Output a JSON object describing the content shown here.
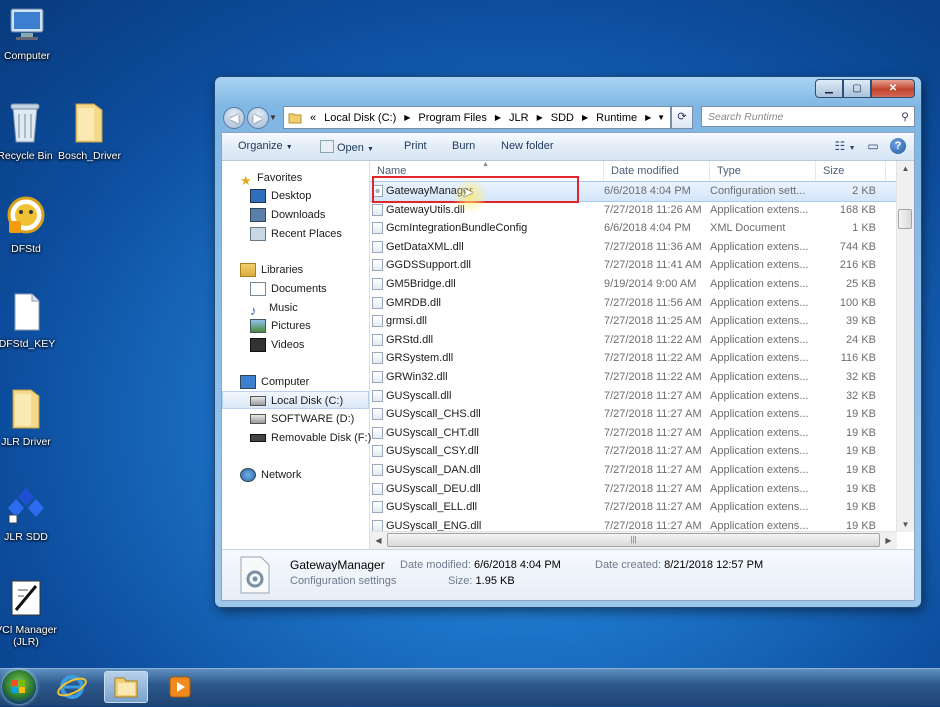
{
  "desktop": {
    "icons": [
      {
        "label": "Computer"
      },
      {
        "label": "Recycle Bin"
      },
      {
        "label": "Bosch_Driver"
      },
      {
        "label": "DFStd"
      },
      {
        "label": "DFStd_KEY"
      },
      {
        "label": "JLR Driver"
      },
      {
        "label": "JLR SDD"
      },
      {
        "label": "VCI Manager (JLR)"
      }
    ]
  },
  "explorer": {
    "address": {
      "prefix": "«",
      "segments": [
        "Local Disk (C:)",
        "Program Files",
        "JLR",
        "SDD",
        "Runtime"
      ]
    },
    "search_placeholder": "Search Runtime",
    "toolbar": {
      "organize": "Organize",
      "open": "Open",
      "print": "Print",
      "burn": "Burn",
      "new_folder": "New folder"
    },
    "nav": {
      "favorites": "Favorites",
      "desktop": "Desktop",
      "downloads": "Downloads",
      "recent": "Recent Places",
      "libraries": "Libraries",
      "documents": "Documents",
      "music": "Music",
      "pictures": "Pictures",
      "videos": "Videos",
      "computer": "Computer",
      "local_disk": "Local Disk (C:)",
      "software": "SOFTWARE (D:)",
      "removable": "Removable Disk (F:)",
      "network": "Network"
    },
    "columns": {
      "name": "Name",
      "date": "Date modified",
      "type": "Type",
      "size": "Size"
    },
    "files": [
      {
        "name": "GatewayManager",
        "date": "6/6/2018 4:04 PM",
        "type": "Configuration sett...",
        "size": "2 KB",
        "selected": true
      },
      {
        "name": "GatewayUtils.dll",
        "date": "7/27/2018 11:26 AM",
        "type": "Application extens...",
        "size": "168 KB"
      },
      {
        "name": "GcmIntegrationBundleConfig",
        "date": "6/6/2018 4:04 PM",
        "type": "XML Document",
        "size": "1 KB"
      },
      {
        "name": "GetDataXML.dll",
        "date": "7/27/2018 11:36 AM",
        "type": "Application extens...",
        "size": "744 KB"
      },
      {
        "name": "GGDSSupport.dll",
        "date": "7/27/2018 11:41 AM",
        "type": "Application extens...",
        "size": "216 KB"
      },
      {
        "name": "GM5Bridge.dll",
        "date": "9/19/2014 9:00 AM",
        "type": "Application extens...",
        "size": "25 KB"
      },
      {
        "name": "GMRDB.dll",
        "date": "7/27/2018 11:56 AM",
        "type": "Application extens...",
        "size": "100 KB"
      },
      {
        "name": "grmsi.dll",
        "date": "7/27/2018 11:25 AM",
        "type": "Application extens...",
        "size": "39 KB"
      },
      {
        "name": "GRStd.dll",
        "date": "7/27/2018 11:22 AM",
        "type": "Application extens...",
        "size": "24 KB"
      },
      {
        "name": "GRSystem.dll",
        "date": "7/27/2018 11:22 AM",
        "type": "Application extens...",
        "size": "116 KB"
      },
      {
        "name": "GRWin32.dll",
        "date": "7/27/2018 11:22 AM",
        "type": "Application extens...",
        "size": "32 KB"
      },
      {
        "name": "GUSyscall.dll",
        "date": "7/27/2018 11:27 AM",
        "type": "Application extens...",
        "size": "32 KB"
      },
      {
        "name": "GUSyscall_CHS.dll",
        "date": "7/27/2018 11:27 AM",
        "type": "Application extens...",
        "size": "19 KB"
      },
      {
        "name": "GUSyscall_CHT.dll",
        "date": "7/27/2018 11:27 AM",
        "type": "Application extens...",
        "size": "19 KB"
      },
      {
        "name": "GUSyscall_CSY.dll",
        "date": "7/27/2018 11:27 AM",
        "type": "Application extens...",
        "size": "19 KB"
      },
      {
        "name": "GUSyscall_DAN.dll",
        "date": "7/27/2018 11:27 AM",
        "type": "Application extens...",
        "size": "19 KB"
      },
      {
        "name": "GUSyscall_DEU.dll",
        "date": "7/27/2018 11:27 AM",
        "type": "Application extens...",
        "size": "19 KB"
      },
      {
        "name": "GUSyscall_ELL.dll",
        "date": "7/27/2018 11:27 AM",
        "type": "Application extens...",
        "size": "19 KB"
      },
      {
        "name": "GUSyscall_ENG.dll",
        "date": "7/27/2018 11:27 AM",
        "type": "Application extens...",
        "size": "19 KB"
      }
    ],
    "details": {
      "name": "GatewayManager",
      "type": "Configuration settings",
      "modified_label": "Date modified:",
      "modified_value": "6/6/2018 4:04 PM",
      "size_label": "Size:",
      "size_value": "1.95 KB",
      "created_label": "Date created:",
      "created_value": "8/21/2018 12:57 PM"
    }
  },
  "colors": {
    "highlight_box": "#e0262a",
    "selection": "#d4e6fb"
  }
}
